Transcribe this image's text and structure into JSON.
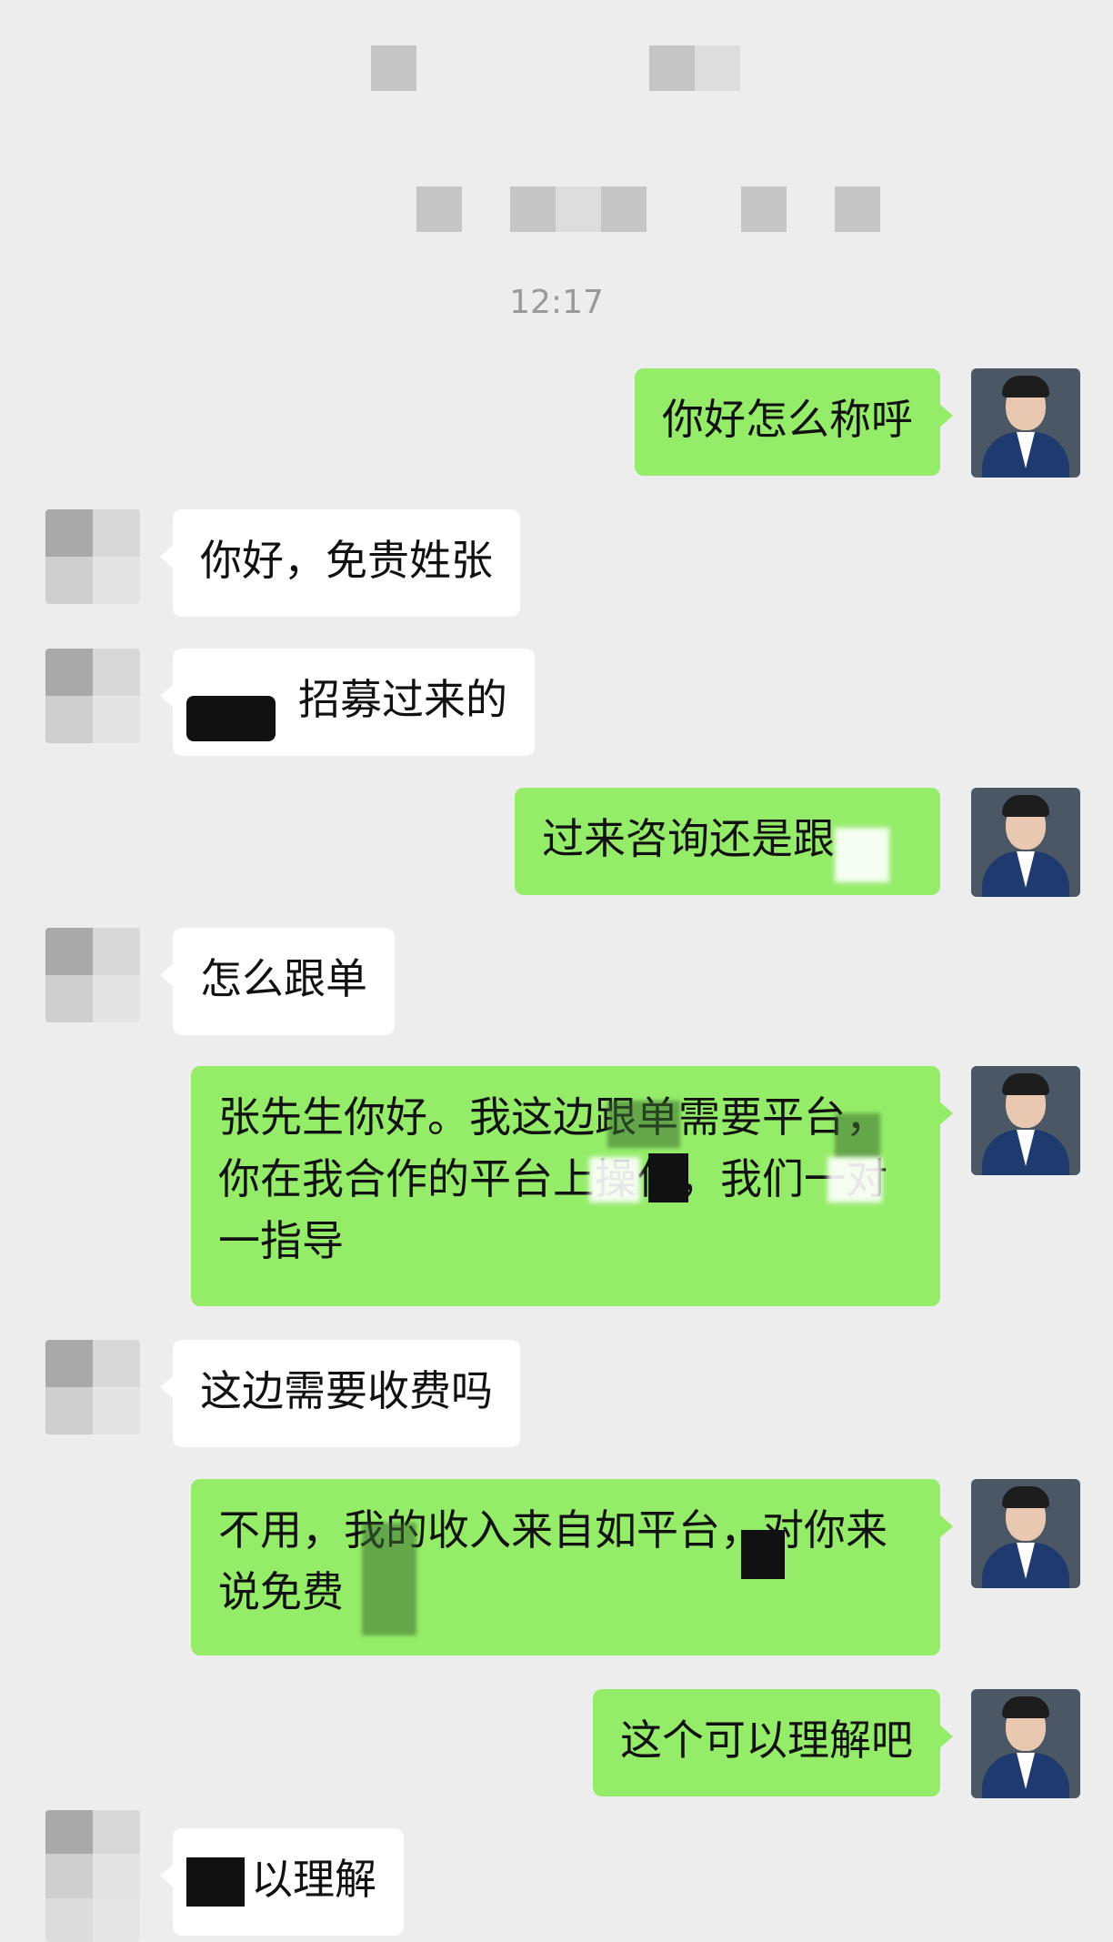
{
  "chat": {
    "timestamp": "12:17",
    "messages": [
      {
        "from": "me",
        "text": "你好怎么称呼"
      },
      {
        "from": "them",
        "text": "你好，免贵姓张"
      },
      {
        "from": "them",
        "text": "招募过来的"
      },
      {
        "from": "me",
        "text": "过来咨询还是跟"
      },
      {
        "from": "them",
        "text": "怎么跟单"
      },
      {
        "from": "me",
        "text": "张先生你好。我这边跟单需要平台，你在我合作的平台上操作，我们一对一指导"
      },
      {
        "from": "them",
        "text": "这边需要收费吗"
      },
      {
        "from": "me",
        "text": "不用，我的收入来自如平台，对你来说免费"
      },
      {
        "from": "me",
        "text": "这个可以理解吧"
      },
      {
        "from": "them",
        "text": "以理解"
      }
    ]
  },
  "colors": {
    "background": "#ededed",
    "my_bubble": "#95ec69",
    "their_bubble": "#ffffff"
  }
}
